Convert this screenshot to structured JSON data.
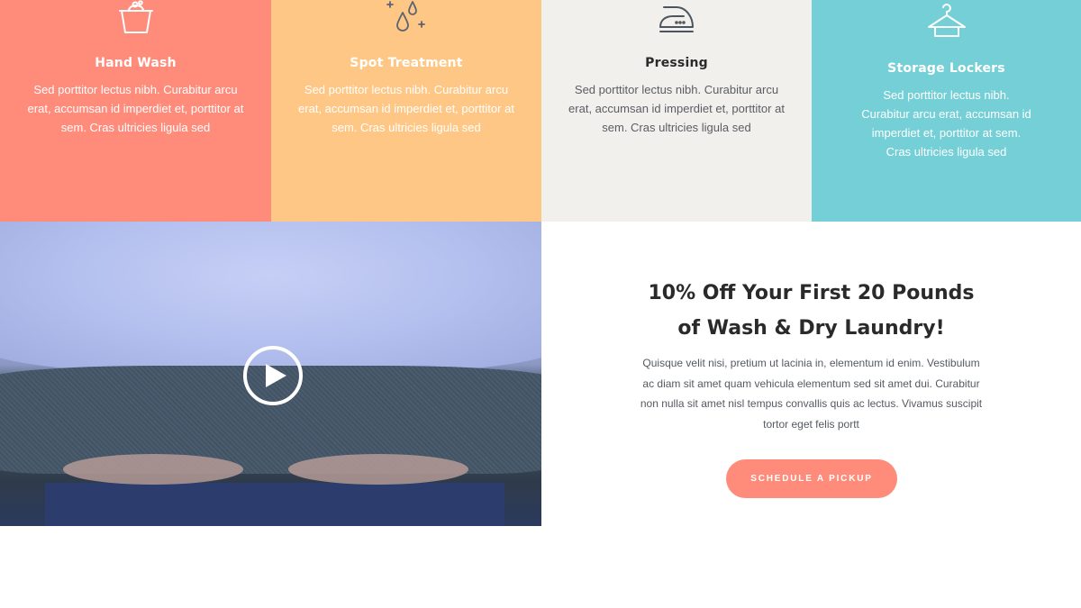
{
  "services": [
    {
      "title": "Hand Wash",
      "icon": "bucket-icon",
      "description": "Sed porttitor lectus nibh. Curabitur arcu erat, accumsan id imperdiet et, porttitor at sem. Cras ultricies ligula sed",
      "color": "#ff8b7b"
    },
    {
      "title": "Spot Treatment",
      "icon": "droplets-sparkle-icon",
      "description": "Sed porttitor lectus nibh. Curabitur arcu erat, accumsan id imperdiet et, porttitor at sem. Cras ultricies ligula sed",
      "color": "#ffc785"
    },
    {
      "title": "Pressing",
      "icon": "iron-icon",
      "description": "Sed porttitor lectus nibh. Curabitur arcu erat, accumsan id imperdiet et, porttitor at sem. Cras ultricies ligula sed",
      "color": "#f2f0ed"
    },
    {
      "title": "Storage Lockers",
      "icon": "hanger-icon",
      "description": "Sed porttitor lectus nibh. Curabitur arcu erat, accumsan id imperdiet et, porttitor at sem. Cras ultricies ligula sed",
      "color": "#75cfd6"
    }
  ],
  "video": {
    "icon": "play-icon"
  },
  "promo": {
    "heading_line1": "10% Off Your First 20 Pounds",
    "heading_line2": "of Wash & Dry Laundry!",
    "body": "Quisque velit nisi, pretium ut lacinia in, elementum id enim. Vestibulum ac diam sit amet quam vehicula elementum sed sit amet dui. Curabitur non nulla sit amet nisl tempus convallis quis ac lectus. Vivamus suscipit tortor eget felis portt",
    "button_label": "SCHEDULE A PICKUP",
    "accent_color": "#ff8b7b"
  }
}
